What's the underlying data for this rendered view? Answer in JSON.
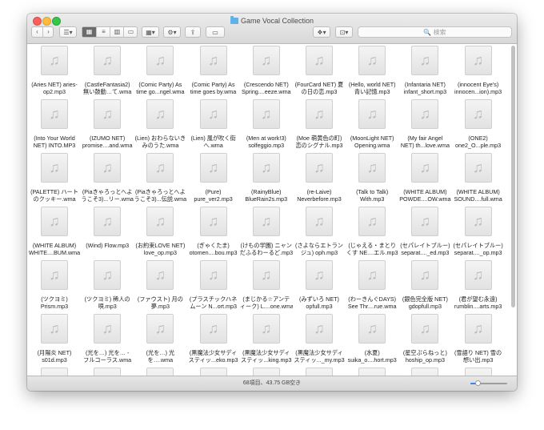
{
  "window": {
    "title": "Game Vocal Collection"
  },
  "toolbar": {
    "back_glyph": "‹",
    "forward_glyph": "›",
    "arrange_glyph": "☰▾",
    "gear_glyph": "⚙▾",
    "dropbox_glyph": "❖▾",
    "share_glyph": "⇪",
    "tag_glyph": "▭",
    "sort_glyph": "▦▾",
    "lock_glyph": "⊡▾",
    "view_icon_glyph": "▦",
    "view_list_glyph": "≡",
    "view_column_glyph": "▥",
    "view_cover_glyph": "▭",
    "search_placeholder": "🔍 検索"
  },
  "file_icon_glyph": "♫",
  "files": [
    [
      "(Aries NET) aries-",
      "op2.mp3"
    ],
    [
      "(CastleFantasia2)",
      "無い鼓動…て.wma"
    ],
    [
      "(Comic Party) As",
      "time go...ngel.wma"
    ],
    [
      "(Comic Party) As",
      "time goes by.wma"
    ],
    [
      "(Crescendo NET)",
      "Spring....eeze.wma"
    ],
    [
      "(FourCard NET) 夏",
      "の日の恋.mp3"
    ],
    [
      "(Hello, world NET)",
      "青い記憶.mp3"
    ],
    [
      "(Infantaria NET)",
      "infant_short.mp3"
    ],
    [
      "(innocent Eye's)",
      "innocen...ion).mp3"
    ],
    [
      "(Into Your World",
      "NET) INTO.MP3"
    ],
    [
      "(IZUMO NET)",
      "promise....and.wma"
    ],
    [
      "(Lien) おわらないき",
      "みのうた.wma"
    ],
    [
      "(Lien) 風が吹く街",
      "へ.wma"
    ],
    [
      "(Men at work!3)",
      "solfeggio.mp3"
    ],
    [
      "(Moe 萌黄色の町)",
      "恋のシグナル.mp3"
    ],
    [
      "(MoonLight NET)",
      "Opening.wma"
    ],
    [
      "(My fair Angel",
      "NET) th...love.wma"
    ],
    [
      "(ONE2)",
      "one2_O...ple.mp3"
    ],
    [
      "(PALETTE) ハート",
      "のクッキー.wma"
    ],
    [
      "(Piaきゃろっとへよ",
      "うこそ3)...リー.wma"
    ],
    [
      "(Piaきゃろっとへよ",
      "うこそ3)...伝説.wma"
    ],
    [
      "(Pure)",
      "pure_ver2.mp3"
    ],
    [
      "(RainyBlue)",
      "BlueRain2s.mp3"
    ],
    [
      "(re-Laive)",
      "Neverbefore.mp3"
    ],
    [
      "(Talk to Talk)",
      "With.mp3"
    ],
    [
      "(WHITE ALBUM)",
      "POWDE....OW.wma"
    ],
    [
      "(WHITE ALBUM)",
      "SOUND....full.wma"
    ],
    [
      "(WHITE ALBUM)",
      "WHITE....BUM.wma"
    ],
    [
      "(Wind) Flow.mp3",
      ""
    ],
    [
      "(お約束LOVE NET)",
      "love_op.mp3"
    ],
    [
      "(ぎゃくたま)",
      "otomen....bou.mp3"
    ],
    [
      "(けもの学園) ニャン",
      "だふるわーるど.mp3"
    ],
    [
      "(さよならエトラン",
      "ジュ) oph.mp3"
    ],
    [
      "(じゃえる・まとり",
      "くす NE....エル.mp3"
    ],
    [
      "(セパレイトブルー)",
      "separat...._ed.mp3"
    ],
    [
      "(セパレイトブルー)",
      "separat...._op.mp3"
    ],
    [
      "(ツクヨミ)",
      "Prism.mp3"
    ],
    [
      "(ツクヨミ) 稀人の",
      "唄.mp3"
    ],
    [
      "(ファウスト) 月の",
      "夢.mp3"
    ],
    [
      "(プラスチックハネ",
      "ムーン N...ort.mp3"
    ],
    [
      "(まじかる☆アンテ",
      "ィーク) L....one.wma"
    ],
    [
      "(みずいろ NET)",
      "opfull.mp3"
    ],
    [
      "(わーきんぐDAYS)",
      "See Thr....rue.wma"
    ],
    [
      "(銀色完全版 NET)",
      "gdopfull.mp3"
    ],
    [
      "(君が望む永遠)",
      "rumblin....arts.mp3"
    ],
    [
      "(月陽炎 NET)",
      "s01d.mp3"
    ],
    [
      "(光を…) 光を… -",
      "フルコーラス.wma"
    ],
    [
      "(光を…) 光",
      "を….wma"
    ],
    [
      "(黒魔法少女サディ",
      "スティッ...eko.mp3"
    ],
    [
      "(黒魔法少女サディ",
      "スティッ...king.mp3"
    ],
    [
      "(黒魔法少女サディ",
      "スティッ..._my.mp3"
    ],
    [
      "(水夏)",
      "suika_o....hort.mp3"
    ],
    [
      "(星空ぷらねっと)",
      "hoship_op.mp3"
    ],
    [
      "(雪語り NET) 雪の",
      "想い出.mp3"
    ],
    [
      "",
      ""
    ],
    [
      "",
      ""
    ],
    [
      "",
      ""
    ],
    [
      "",
      ""
    ],
    [
      "",
      ""
    ],
    [
      "",
      ""
    ],
    [
      "",
      ""
    ],
    [
      "",
      ""
    ],
    [
      "",
      ""
    ]
  ],
  "status": {
    "text": "68項目、43.75 GB空き"
  },
  "zoom": {
    "fraction": 0.2
  }
}
